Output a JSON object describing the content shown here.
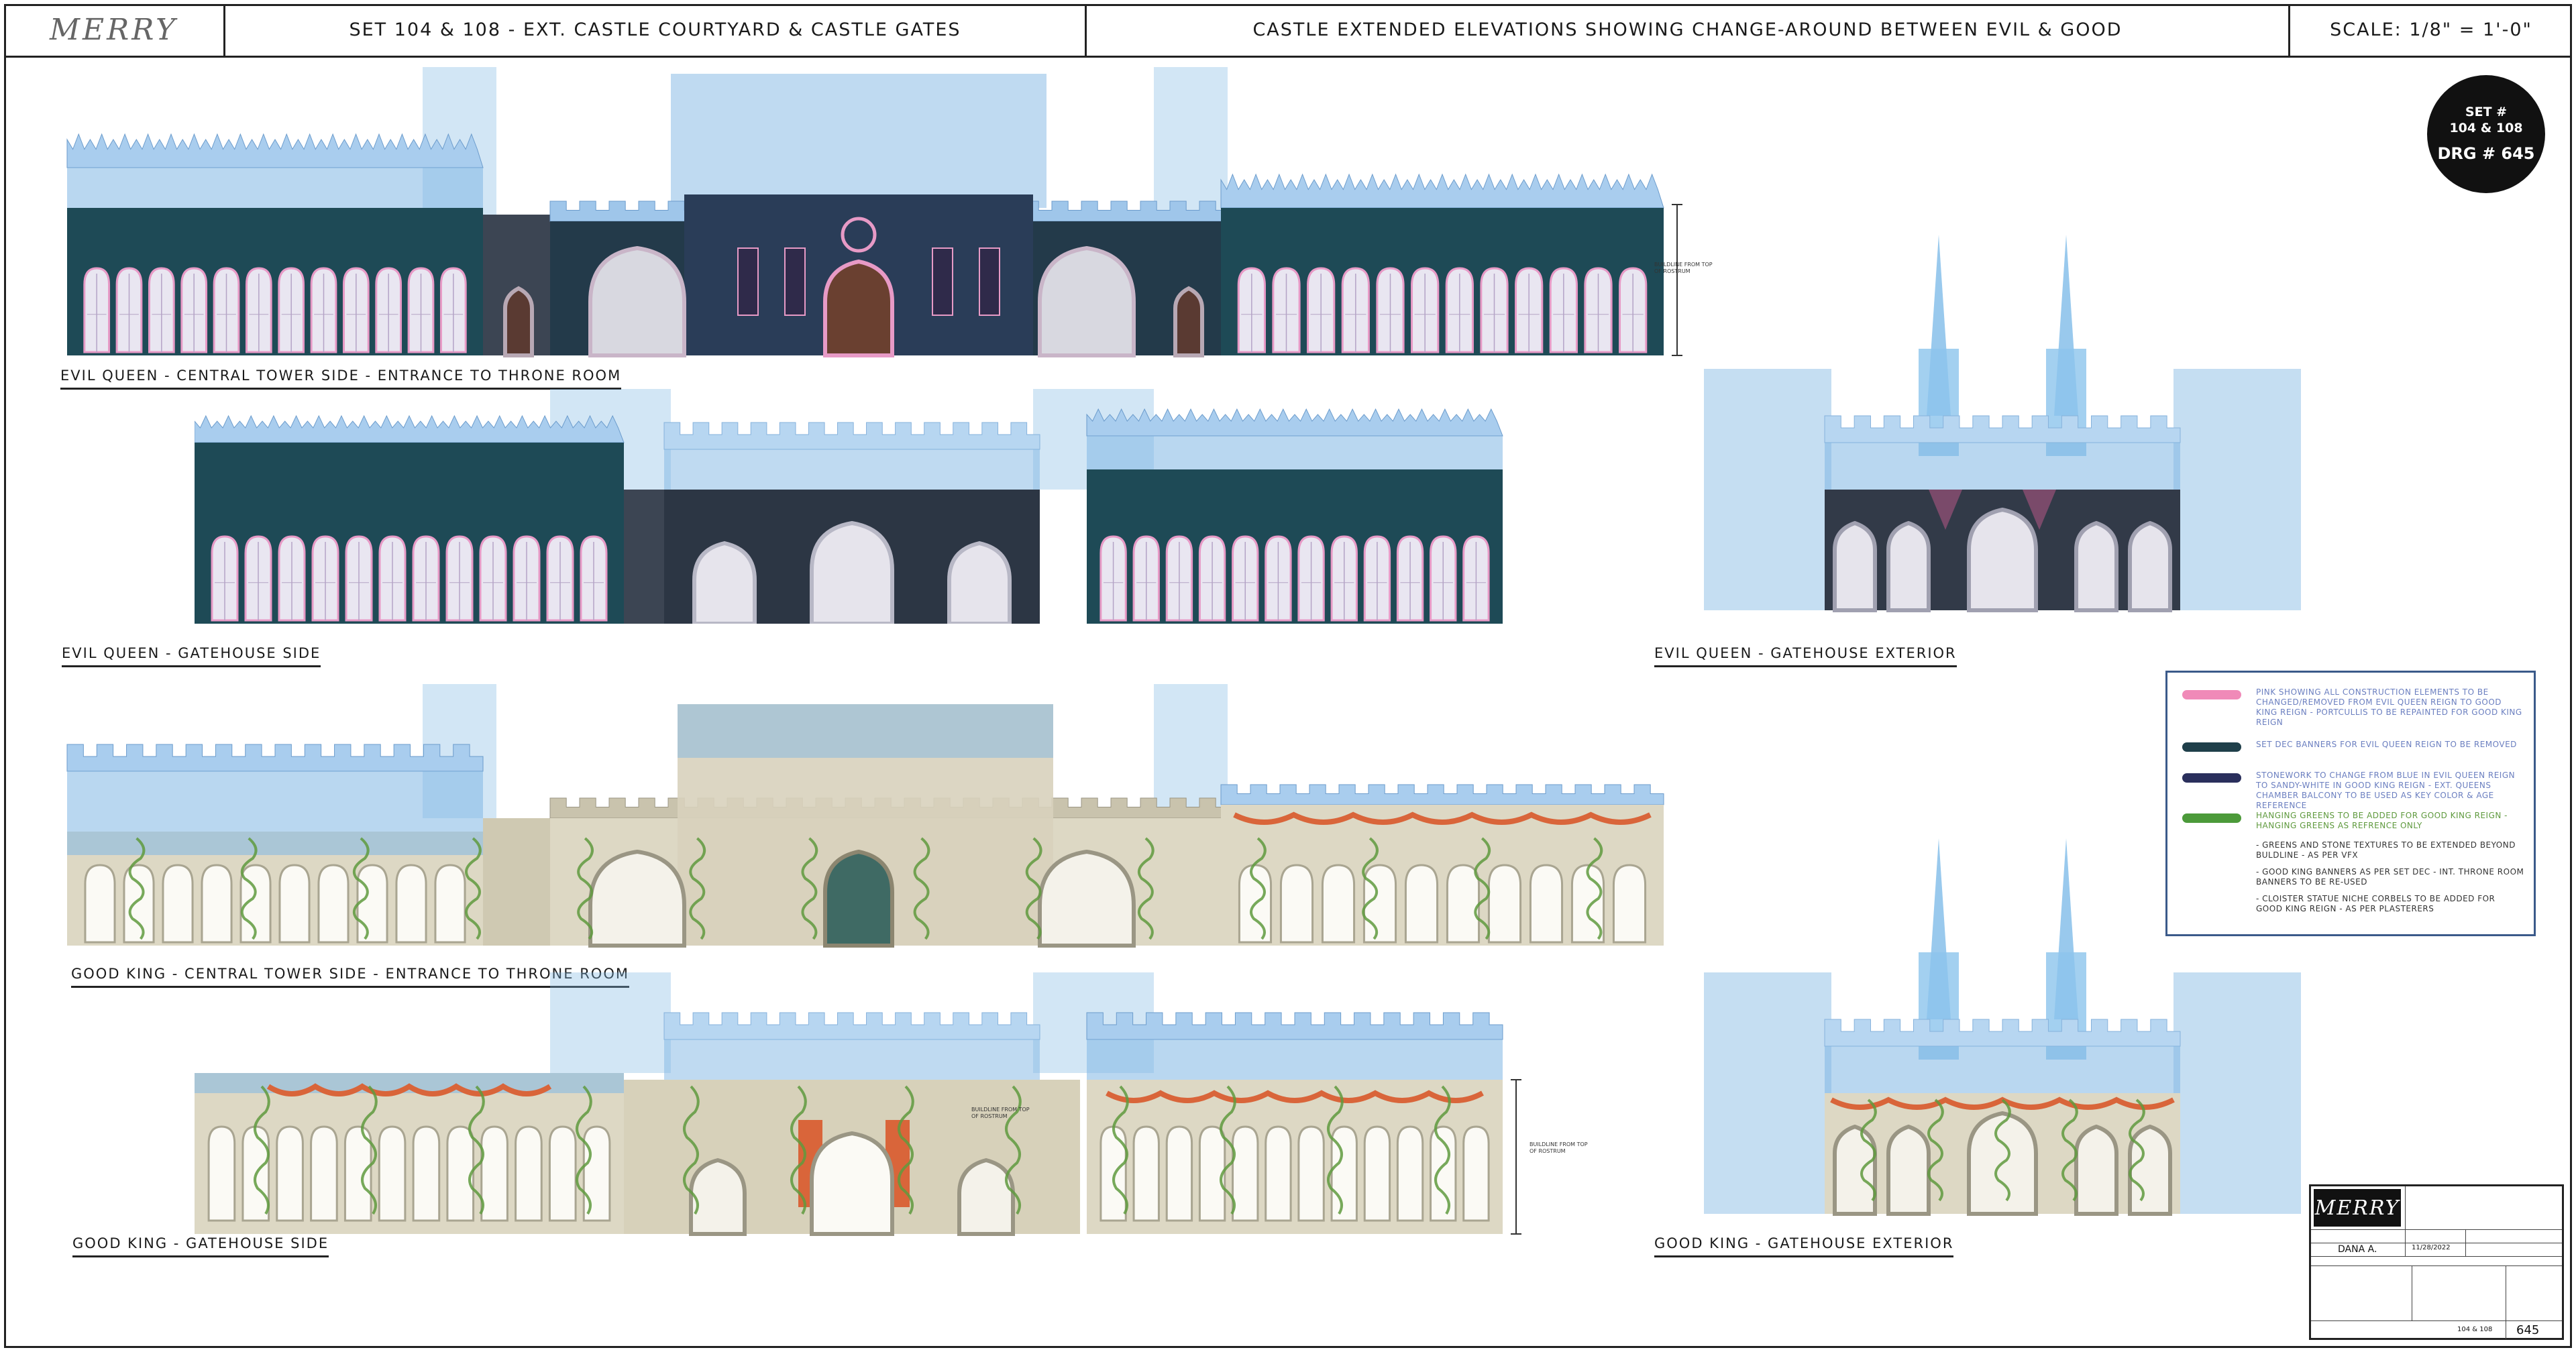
{
  "header": {
    "logo": "MERRY",
    "set_title": "SET 104 & 108  - EXT. CASTLE COURTYARD & CASTLE GATES",
    "sheet_title": "CASTLE EXTENDED ELEVATIONS  SHOWING CHANGE-AROUND BETWEEN EVIL & GOOD",
    "scale": "SCALE:  1/8\" = 1'-0\""
  },
  "badge": {
    "set": "SET #",
    "set_numbers": "104 & 108",
    "drawing": "DRG # 645"
  },
  "elevations": {
    "e1": "EVIL QUEEN - CENTRAL TOWER SIDE - ENTRANCE TO THRONE ROOM",
    "e2": "EVIL QUEEN - GATEHOUSE SIDE",
    "e3": "EVIL QUEEN - GATEHOUSE EXTERIOR",
    "e4": "GOOD KING - CENTRAL TOWER SIDE - ENTRANCE TO THRONE ROOM",
    "e5": "GOOD KING - GATEHOUSE SIDE",
    "e6": "GOOD KING - GATEHOUSE EXTERIOR"
  },
  "legend": {
    "items": [
      {
        "color": "#f08ab8",
        "text": "PINK SHOWING ALL CONSTRUCTION ELEMENTS TO BE CHANGED/REMOVED FROM EVIL QUEEN REIGN TO GOOD KING REIGN - PORTCULLIS TO BE REPAINTED FOR GOOD KING REIGN"
      },
      {
        "color": "#1f3f4a",
        "text": "SET DEC BANNERS FOR EVIL QUEEN REIGN TO BE REMOVED"
      },
      {
        "color": "#2a2f5c",
        "text": "STONEWORK TO CHANGE FROM BLUE IN EVIL QUEEN REIGN TO SANDY-WHITE IN GOOD KING REIGN - EXT. QUEENS CHAMBER BALCONY TO BE USED AS KEY COLOR & AGE REFERENCE"
      },
      {
        "color": "#4c9a3a",
        "text": "HANGING GREENS TO BE ADDED FOR GOOD KING REIGN - HANGING GREENS AS REFRENCE ONLY"
      }
    ],
    "notes": [
      "- GREENS AND STONE TEXTURES TO BE EXTENDED BEYOND BULDLINE - AS PER VFX",
      "- GOOD KING BANNERS AS PER SET DEC - INT. THRONE ROOM BANNERS TO BE RE-USED",
      "- CLOISTER STATUE NICHE CORBELS TO BE ADDED FOR GOOD KING REIGN - AS PER PLASTERERS"
    ]
  },
  "annotations": {
    "buildline": "BUILDLINE FROM TOP OF ROSTRUM"
  },
  "title_block": {
    "logo": "MERRY",
    "designer": "DANA A.",
    "date": "11/28/2022",
    "sets": "104 & 108",
    "drawing_no": "645"
  },
  "colors": {
    "evil_wall": "#1e4a56",
    "evil_stone": "#3c4553",
    "good_stone": "#ddd8c4",
    "vfx_blue": "#7fb6e3",
    "pink_trim": "#e79ac6",
    "green": "#5f9a3e",
    "orange_garland": "#d9653a"
  }
}
